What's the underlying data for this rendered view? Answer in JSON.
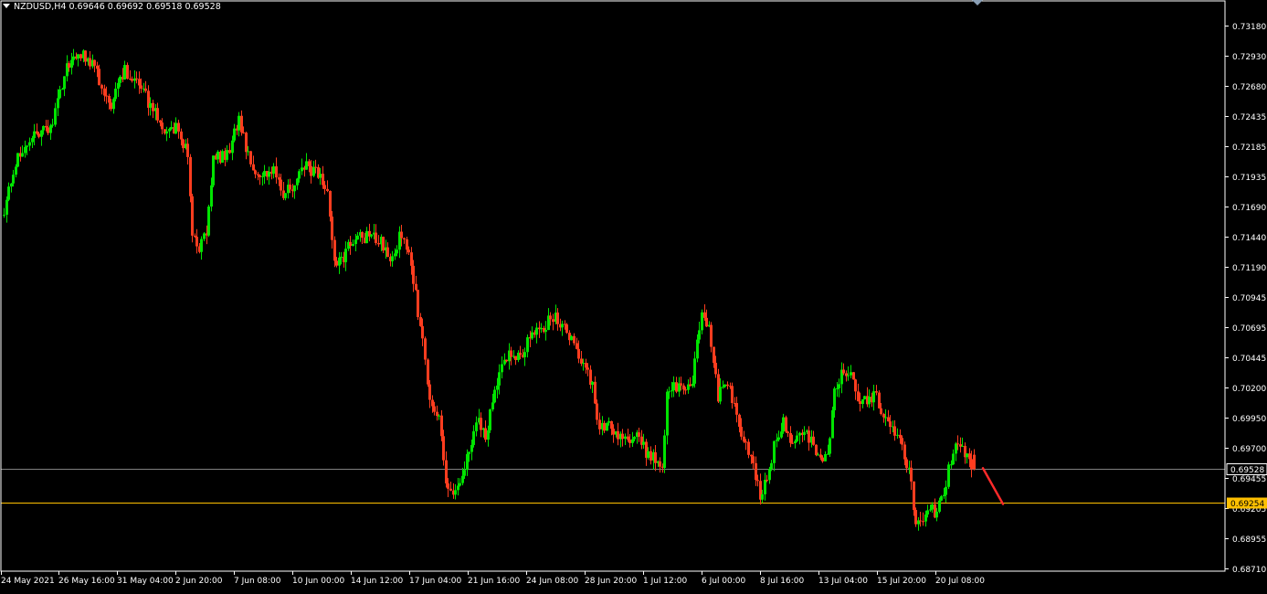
{
  "header": {
    "symbol": "NZDUSD,H4",
    "open": "0.69646",
    "high": "0.69692",
    "low": "0.69518",
    "close": "0.69528"
  },
  "colors": {
    "background": "#000000",
    "bull": "#00E400",
    "bear": "#FF3D1F",
    "axis": "#FFFFFF",
    "bid_line": "#808080",
    "level_line": "#FFC000",
    "arrow": "#FF2A2A"
  },
  "chart_data": {
    "type": "candlestick",
    "symbol": "NZDUSD",
    "timeframe": "H4",
    "ylim": [
      0.6871,
      0.7318
    ],
    "y_ticks": [
      "0.73180",
      "0.72930",
      "0.72680",
      "0.72435",
      "0.72185",
      "0.71935",
      "0.71690",
      "0.71440",
      "0.71190",
      "0.70945",
      "0.70695",
      "0.70445",
      "0.70200",
      "0.69950",
      "0.69700",
      "0.69455",
      "0.69205",
      "0.68955",
      "0.68710"
    ],
    "x_ticks": [
      "24 May 2021",
      "26 May 16:00",
      "31 May 04:00",
      "2 Jun 20:00",
      "7 Jun 08:00",
      "10 Jun 00:00",
      "14 Jun 12:00",
      "17 Jun 04:00",
      "21 Jun 16:00",
      "24 Jun 08:00",
      "28 Jun 20:00",
      "1 Jul 12:00",
      "6 Jul 00:00",
      "8 Jul 16:00",
      "13 Jul 04:00",
      "15 Jul 20:00",
      "20 Jul 08:00"
    ],
    "current_price": {
      "label": "0.69528",
      "value": 0.69528
    },
    "level_line": {
      "label": "0.69254",
      "value": 0.69254
    },
    "projection_arrow": {
      "from": 0.69528,
      "to": 0.6924,
      "direction": "down"
    },
    "close_path": [
      [
        0,
        0.7166
      ],
      [
        6,
        0.7211
      ],
      [
        14,
        0.7231
      ],
      [
        20,
        0.7232
      ],
      [
        27,
        0.7286
      ],
      [
        33,
        0.7294
      ],
      [
        39,
        0.7286
      ],
      [
        45,
        0.725
      ],
      [
        52,
        0.7281
      ],
      [
        58,
        0.727
      ],
      [
        64,
        0.7248
      ],
      [
        69,
        0.7234
      ],
      [
        75,
        0.7233
      ],
      [
        79,
        0.7212
      ],
      [
        81,
        0.7144
      ],
      [
        84,
        0.7133
      ],
      [
        87,
        0.7147
      ],
      [
        90,
        0.7207
      ],
      [
        96,
        0.7212
      ],
      [
        101,
        0.7239
      ],
      [
        106,
        0.7205
      ],
      [
        111,
        0.7195
      ],
      [
        116,
        0.7198
      ],
      [
        120,
        0.7181
      ],
      [
        125,
        0.7188
      ],
      [
        130,
        0.7202
      ],
      [
        135,
        0.7195
      ],
      [
        139,
        0.718
      ],
      [
        142,
        0.7124
      ],
      [
        146,
        0.7128
      ],
      [
        151,
        0.7146
      ],
      [
        157,
        0.7143
      ],
      [
        162,
        0.7142
      ],
      [
        166,
        0.7125
      ],
      [
        170,
        0.7143
      ],
      [
        174,
        0.7132
      ],
      [
        177,
        0.7097
      ],
      [
        180,
        0.7055
      ],
      [
        183,
        0.7012
      ],
      [
        187,
        0.6995
      ],
      [
        190,
        0.694
      ],
      [
        193,
        0.693
      ],
      [
        198,
        0.6952
      ],
      [
        203,
        0.6992
      ],
      [
        207,
        0.6982
      ],
      [
        212,
        0.7023
      ],
      [
        217,
        0.7052
      ],
      [
        222,
        0.7043
      ],
      [
        226,
        0.7062
      ],
      [
        232,
        0.707
      ],
      [
        237,
        0.708
      ],
      [
        241,
        0.7068
      ],
      [
        245,
        0.7056
      ],
      [
        249,
        0.7041
      ],
      [
        253,
        0.702
      ],
      [
        256,
        0.6985
      ],
      [
        260,
        0.6988
      ],
      [
        264,
        0.698
      ],
      [
        268,
        0.6975
      ],
      [
        272,
        0.6985
      ],
      [
        276,
        0.6965
      ],
      [
        280,
        0.696
      ],
      [
        283,
        0.6958
      ],
      [
        285,
        0.7012
      ],
      [
        288,
        0.7022
      ],
      [
        292,
        0.7018
      ],
      [
        296,
        0.7022
      ],
      [
        298,
        0.706
      ],
      [
        300,
        0.7085
      ],
      [
        303,
        0.707
      ],
      [
        307,
        0.7012
      ],
      [
        311,
        0.7025
      ],
      [
        315,
        0.6995
      ],
      [
        319,
        0.6975
      ],
      [
        322,
        0.6955
      ],
      [
        325,
        0.6932
      ],
      [
        328,
        0.6945
      ],
      [
        331,
        0.6972
      ],
      [
        335,
        0.6992
      ],
      [
        339,
        0.6975
      ],
      [
        343,
        0.6985
      ],
      [
        347,
        0.6975
      ],
      [
        351,
        0.696
      ],
      [
        354,
        0.6968
      ],
      [
        357,
        0.7015
      ],
      [
        361,
        0.7035
      ],
      [
        364,
        0.703
      ],
      [
        368,
        0.7005
      ],
      [
        371,
        0.701
      ],
      [
        375,
        0.7012
      ],
      [
        379,
        0.6992
      ],
      [
        383,
        0.6985
      ],
      [
        386,
        0.697
      ],
      [
        389,
        0.6952
      ],
      [
        392,
        0.691
      ],
      [
        395,
        0.6905
      ],
      [
        398,
        0.6925
      ],
      [
        401,
        0.6915
      ],
      [
        404,
        0.6935
      ],
      [
        408,
        0.6968
      ],
      [
        411,
        0.697
      ],
      [
        414,
        0.6964
      ],
      [
        417,
        0.6953
      ]
    ]
  }
}
